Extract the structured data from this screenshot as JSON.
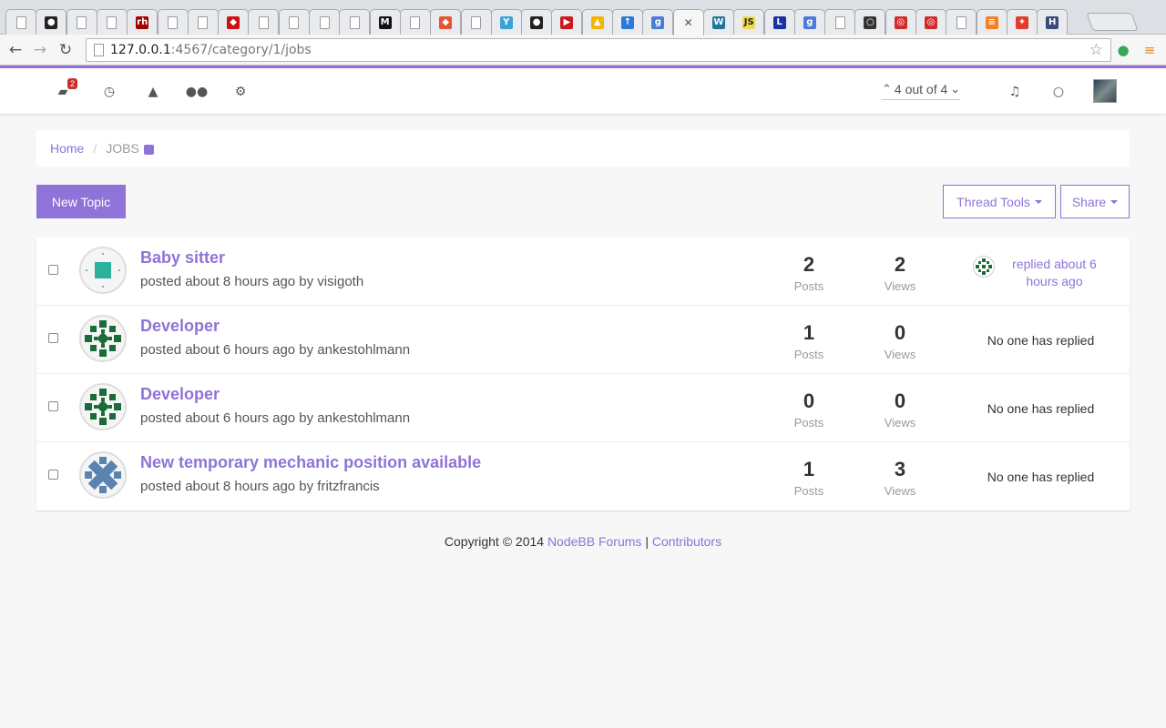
{
  "browser": {
    "url_host": "127.0.0.1",
    "url_path": ":4567/category/1/jobs",
    "tab_icons": [
      {
        "name": "page-icon",
        "bg": "",
        "glyph": ""
      },
      {
        "name": "github-icon",
        "bg": "#222222",
        "glyph": "●"
      },
      {
        "name": "page-icon",
        "bg": "",
        "glyph": ""
      },
      {
        "name": "page-icon",
        "bg": "",
        "glyph": ""
      },
      {
        "name": "redhat-icon",
        "bg": "#a30000",
        "glyph": "rh"
      },
      {
        "name": "page-icon",
        "bg": "",
        "glyph": ""
      },
      {
        "name": "page-icon",
        "bg": "",
        "glyph": ""
      },
      {
        "name": "ruby-icon",
        "bg": "#cc1111",
        "glyph": "◆"
      },
      {
        "name": "page-icon",
        "bg": "",
        "glyph": ""
      },
      {
        "name": "page-icon",
        "bg": "",
        "glyph": ""
      },
      {
        "name": "page-icon",
        "bg": "",
        "glyph": ""
      },
      {
        "name": "page-icon",
        "bg": "",
        "glyph": ""
      },
      {
        "name": "medium-icon",
        "bg": "#111111",
        "glyph": "M"
      },
      {
        "name": "page-icon",
        "bg": "",
        "glyph": ""
      },
      {
        "name": "git-icon",
        "bg": "#e4542f",
        "glyph": "◆"
      },
      {
        "name": "page-icon",
        "bg": "",
        "glyph": ""
      },
      {
        "name": "funnel-icon",
        "bg": "#3aa3d6",
        "glyph": "Y"
      },
      {
        "name": "github-icon",
        "bg": "#222222",
        "glyph": "●"
      },
      {
        "name": "youtube-icon",
        "bg": "#cc181e",
        "glyph": "▶"
      },
      {
        "name": "drive-icon",
        "bg": "#f4b400",
        "glyph": "▲"
      },
      {
        "name": "upload-icon",
        "bg": "#2d7ad6",
        "glyph": "↑"
      },
      {
        "name": "google-icon",
        "bg": "#4a7bd8",
        "glyph": "g"
      },
      {
        "name": "close-icon",
        "bg": "",
        "glyph": "✕"
      },
      {
        "name": "wordpress-icon",
        "bg": "#21759b",
        "glyph": "W"
      },
      {
        "name": "js-icon",
        "bg": "#f0db4f",
        "glyph": "JS"
      },
      {
        "name": "l-icon",
        "bg": "#1b2fa6",
        "glyph": "L"
      },
      {
        "name": "google-icon",
        "bg": "#4a7bd8",
        "glyph": "g"
      },
      {
        "name": "page-icon",
        "bg": "",
        "glyph": ""
      },
      {
        "name": "circle-icon",
        "bg": "#333333",
        "glyph": "○"
      },
      {
        "name": "target-icon",
        "bg": "#d12c2c",
        "glyph": "◎"
      },
      {
        "name": "target-icon",
        "bg": "#d12c2c",
        "glyph": "◎"
      },
      {
        "name": "page-icon",
        "bg": "",
        "glyph": ""
      },
      {
        "name": "stackoverflow-icon",
        "bg": "#f48024",
        "glyph": "≡"
      },
      {
        "name": "pinwheel-icon",
        "bg": "#e33b2e",
        "glyph": "✦"
      },
      {
        "name": "h-icon",
        "bg": "#3b4a7a",
        "glyph": "H"
      }
    ]
  },
  "header": {
    "notification_count": "2",
    "pagination_text": "4 out of 4",
    "icons": [
      "inbox-icon",
      "clock-icon",
      "fire-icon",
      "users-icon",
      "gears-icon"
    ]
  },
  "breadcrumb": {
    "home": "Home",
    "current": "JOBS"
  },
  "actions": {
    "new_topic": "New Topic",
    "thread_tools": "Thread Tools",
    "share": "Share"
  },
  "topics": [
    {
      "title": "Baby sitter",
      "meta": "posted about 8 hours ago by visigoth",
      "posts": "2",
      "posts_label": "Posts",
      "views": "2",
      "views_label": "Views",
      "reply": "replied about 6 hours ago",
      "has_reply": true,
      "avatar": "square-avatar"
    },
    {
      "title": "Developer",
      "meta": "posted about 6 hours ago by ankestohlmann",
      "posts": "1",
      "posts_label": "Posts",
      "views": "0",
      "views_label": "Views",
      "reply": "No one has replied",
      "has_reply": false,
      "avatar": "green-pattern-avatar"
    },
    {
      "title": "Developer",
      "meta": "posted about 6 hours ago by ankestohlmann",
      "posts": "0",
      "posts_label": "Posts",
      "views": "0",
      "views_label": "Views",
      "reply": "No one has replied",
      "has_reply": false,
      "avatar": "green-pattern-avatar"
    },
    {
      "title": "New temporary mechanic position available",
      "meta": "posted about 8 hours ago by fritzfrancis",
      "posts": "1",
      "posts_label": "Posts",
      "views": "3",
      "views_label": "Views",
      "reply": "No one has replied",
      "has_reply": false,
      "avatar": "blue-pattern-avatar"
    }
  ],
  "footer": {
    "copyright": "Copyright © 2014",
    "link1": "NodeBB Forums",
    "separator": "|",
    "link2": "Contributors"
  },
  "colors": {
    "accent": "#8f73d9",
    "badge": "#c9302c",
    "avatar_green": "#1b6b3a",
    "avatar_teal": "#2bb19c",
    "avatar_blue": "#5b83b0"
  }
}
